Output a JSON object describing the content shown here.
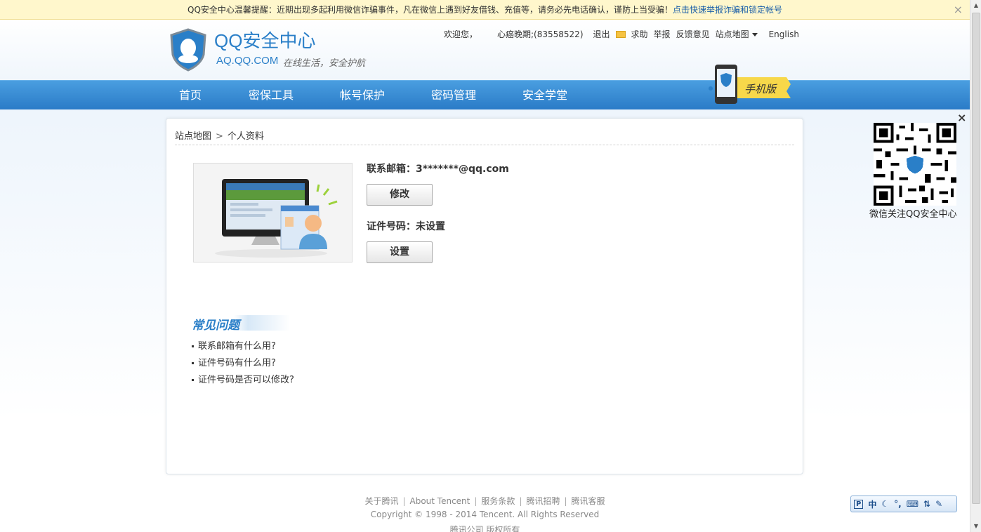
{
  "notice": {
    "prefix": "QQ安全中心温馨提醒：",
    "text": "近期出现多起利用微信诈骗事件，凡在微信上遇到好友借钱、充值等，请务必先电话确认，谨防上当受骗！",
    "link": "点击快速举报诈骗和锁定帐号",
    "close": "×"
  },
  "brand": {
    "title": "QQ安全中心",
    "domain": "AQ.QQ.COM",
    "slogan": "在线生活，安全护航"
  },
  "topbar": {
    "welcome": "欢迎您，",
    "user": "心癌晚期;(83558522)",
    "logout": "退出",
    "help": "求助",
    "report": "举报",
    "feedback": "反馈意见",
    "sitemap": "站点地图",
    "english": "English"
  },
  "nav": {
    "items": [
      "首页",
      "密保工具",
      "帐号保护",
      "密码管理",
      "安全学堂"
    ],
    "mobile": "手机版"
  },
  "breadcrumb": {
    "root": "站点地图",
    "sep": ">",
    "current": "个人资料"
  },
  "profile": {
    "email_label": "联系邮箱：3*******@qq.com",
    "email_button": "修改",
    "id_label": "证件号码：未设置",
    "id_button": "设置"
  },
  "faq": {
    "title": "常见问题",
    "items": [
      "联系邮箱有什么用?",
      "证件号码有什么用?",
      "证件号码是否可以修改?"
    ]
  },
  "qr": {
    "close": "×",
    "caption": "微信关注QQ安全中心"
  },
  "footer": {
    "links": [
      "关于腾讯",
      "About Tencent",
      "服务条款",
      "腾讯招聘",
      "腾讯客服"
    ],
    "copyright": "Copyright © 1998 - 2014 Tencent. All Rights Reserved",
    "company": "腾讯公司 版权所有"
  },
  "ime": {
    "mode": "中"
  }
}
